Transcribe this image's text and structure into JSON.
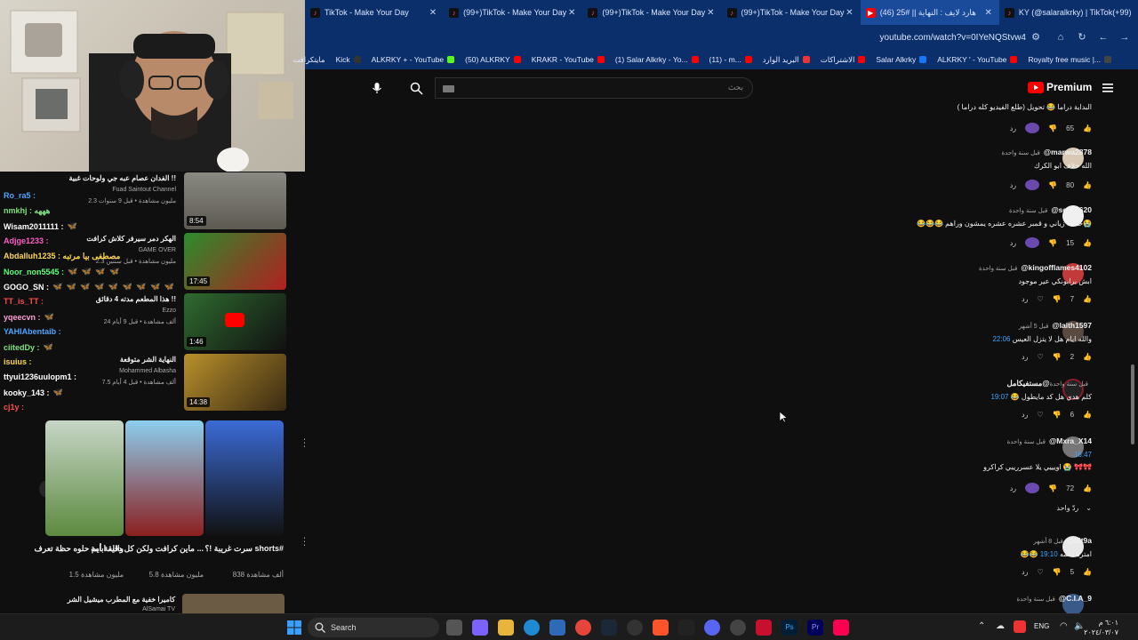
{
  "browser": {
    "tabs": [
      {
        "label": "TikTok - Make Your Day",
        "icon": "tiktok-icon"
      },
      {
        "label": "(99+)TikTok - Make Your Day",
        "icon": "tiktok-icon"
      },
      {
        "label": "(99+)TikTok - Make Your Day",
        "icon": "tiktok-icon"
      },
      {
        "label": "(99+)TikTok - Make Your Day",
        "icon": "tiktok-icon"
      },
      {
        "label": "(46) هارد لايف : النهاية || #25",
        "icon": "youtube-icon"
      },
      {
        "label": "KY (@salaralkrky) | TikTok(+99)",
        "icon": "tiktok-icon"
      }
    ],
    "url": "youtube.com/watch?v=0IYeNQStvw4",
    "bookmarks": [
      "مايتكرافت",
      "Kick",
      "ALKRKY + - YouTube",
      "(50) ALKRKY",
      "KRAKR - YouTube",
      "(1) Salar Alkrky - Yo...",
      "(11) - m...",
      "البريد الوارد",
      "الاشتراكات",
      "Salar Alkrky",
      "ALKRKY ' - YouTube",
      "Royalty free music |..."
    ]
  },
  "chat": [
    {
      "user": "Ro_ra5 :",
      "color": "#4da6ff",
      "emotes": ""
    },
    {
      "user": "nmkhj : هههه",
      "color": "#7fe07f",
      "emotes": ""
    },
    {
      "user": "Wisam2011111 :",
      "color": "#ffffff",
      "emotes": "🦋"
    },
    {
      "user": "Adjge1233 :",
      "color": "#ff5cc8",
      "emotes": ""
    },
    {
      "user": "Abdalluh1235 : مصطفى بيا مرتبه",
      "color": "#ffd84d",
      "emotes": ""
    },
    {
      "user": "Noor_non5545 :",
      "color": "#5cff7a",
      "emotes": "🦋 🦋 🦋 🦋"
    },
    {
      "user": "GOGO_SN :",
      "color": "#ffffff",
      "emotes": "🦋 🦋 🦋 🦋 🦋 🦋 🦋 🦋 🦋"
    },
    {
      "user": "TT_is_TT :",
      "color": "#ff4d4d",
      "emotes": ""
    },
    {
      "user": "yqeecvn :",
      "color": "#ff9fda",
      "emotes": "🦋"
    },
    {
      "user": "YAHIAbentaib :",
      "color": "#4da6ff",
      "emotes": ""
    },
    {
      "user": "ciitedDy :",
      "color": "#7fe07f",
      "emotes": "🦋"
    },
    {
      "user": "isuius :",
      "color": "#ffd84d",
      "emotes": ""
    },
    {
      "user": "ttyui1236uulopm1 :",
      "color": "#ffffff",
      "emotes": ""
    },
    {
      "user": "kooky_143 :",
      "color": "#ffffff",
      "emotes": "🦋"
    },
    {
      "user": "cj1y :",
      "color": "#ff4d4d",
      "emotes": ""
    }
  ],
  "related": [
    {
      "title": "الفدان عصام عبه جي ولوحات غبية !!",
      "channel": "Fuad Saintout Channel",
      "meta": "2.3 مليون مشاهدة • قبل 9 سنوات",
      "duration": "8:54"
    },
    {
      "title": "الهكر دمر سيرفر كلاش كرافت",
      "channel": "GAME OVER",
      "meta": "2.3 مليون مشاهدة • قبل سنتين",
      "duration": "17:45"
    },
    {
      "title": "هذا المطعم مدته 4 دقائق !!",
      "channel": "Ezzo",
      "meta": "24 ألف مشاهدة • قبل 9 أيام",
      "duration": "1:46"
    },
    {
      "title": "النهاية الشر متوقعة",
      "channel": "Mohammed Albasha",
      "meta": "7.5 ألف مشاهدة • قبل 4 أيام",
      "duration": "14:38"
    }
  ],
  "shorts": [
    {
      "title": "سرت غريبة !؟ shorts#",
      "views": "838 ألف مشاهدة"
    },
    {
      "title": "ماين كرافت ولكن كل دقيقة أمة ...",
      "views": "5.8 مليون مشاهدة"
    },
    {
      "title": "والله ابايم حلوه حظة تعرف",
      "views": "1.5 مليون مشاهدة"
    }
  ],
  "bottom_video": {
    "title": "كاميرا خفية مع المطرب ميشيل الشر",
    "channel": "AlSamai TV"
  },
  "search": {
    "placeholder": "بحث"
  },
  "logo": {
    "label": "Premium"
  },
  "comments": [
    {
      "author": "",
      "time": "",
      "text": "البداية دراما 😂 تحويل (طلع الفيديو كله دراما )",
      "ts": "",
      "likes": "65",
      "reply": "رد",
      "heart": false
    },
    {
      "author": "@marwa2878",
      "time": "قبل سنة واحدة",
      "text": "الله خلاف ابو الكرك",
      "ts": "",
      "likes": "80",
      "reply": "رد",
      "heart": false
    },
    {
      "author": "@soor_620",
      "time": "قبل سنة واحدة",
      "text": "😂😂😂 خطيه زياني و قمبر عشره عشره يمشون وراهم😭",
      "ts": "",
      "likes": "15",
      "reply": "رد",
      "heart": false
    },
    {
      "author": "@kingofflames4102",
      "time": "قبل سنة واحدة",
      "text": "ابش برابونكي عير موجود",
      "ts": "",
      "likes": "7",
      "reply": "رد",
      "heart": true
    },
    {
      "author": "@laith1597",
      "time": "قبل 5 أشهر",
      "text": "والله ايام هل لا يتزل العيس",
      "ts": "22:06",
      "likes": "2",
      "reply": "رد",
      "heart": true
    },
    {
      "author": "@مستفيكامل",
      "time": "قبل سنة واحدة",
      "text": "كلم هدي هل كد مايطول 😂",
      "ts": "19:07",
      "likes": "6",
      "reply": "رد",
      "heart": true
    },
    {
      "author": "@Mxra_X14",
      "time": "قبل سنة واحدة",
      "text": "اويييي يلا عسرريبي كراكرو 😭 🎀🎀",
      "ts": "16:47",
      "likes": "72",
      "reply": "رد",
      "heart": false
    },
    {
      "author": "@t5t9a",
      "time": "قبل 8 أشهر",
      "text": "😂😂 امتره دكمه",
      "ts": "19:10",
      "likes": "5",
      "reply": "رد",
      "heart": true
    },
    {
      "author": "@C.I.A_9",
      "time": "قبل سنة واحدة",
      "text": "",
      "ts": "",
      "likes": "",
      "reply": "",
      "heart": false
    }
  ],
  "replies_toggle": "ردّ واحد",
  "taskbar": {
    "search": "Search",
    "lang": "ENG",
    "time": "٦:٠١ م",
    "date": "٢٠٢٤/٠٣/٠٧"
  }
}
